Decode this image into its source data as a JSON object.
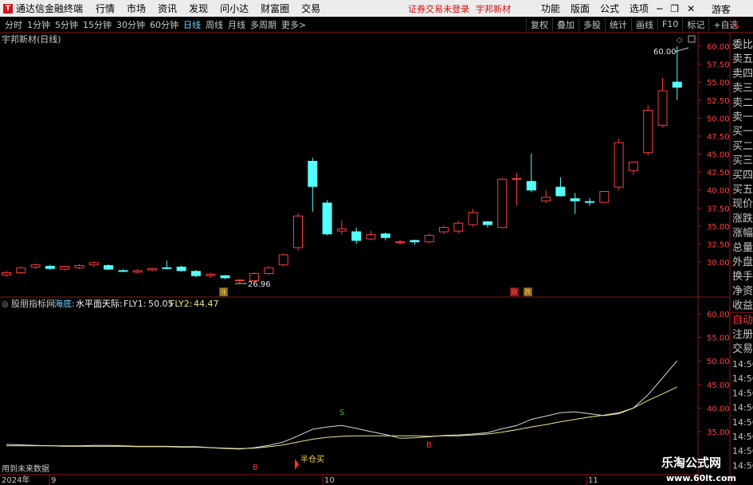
{
  "app": {
    "title": "通达信金融终端",
    "menus": [
      "行情",
      "市场",
      "资讯",
      "发现",
      "问小达",
      "财富圈",
      "交易"
    ],
    "status_left": "证券交易未登录",
    "status_right": "宇邦新材",
    "right_menus": [
      "功能",
      "版面",
      "公式",
      "选项"
    ],
    "guest": "游客"
  },
  "periods": [
    "分时",
    "1分钟",
    "5分钟",
    "15分钟",
    "30分钟",
    "60分钟",
    "日线",
    "周线",
    "月线",
    "多周期",
    "更多>"
  ],
  "active_period": "日线",
  "toolbar": [
    "复权",
    "叠加",
    "多股",
    "统计",
    "画线",
    "F10",
    "标记",
    "+自选"
  ],
  "right_tab": "L",
  "side_tabs": [
    "委比",
    "卖五",
    "卖四",
    "卖三",
    "卖二",
    "卖一",
    "买一",
    "买二",
    "买三",
    "买四",
    "买五",
    "现价",
    "涨跌",
    "涨幅",
    "总量",
    "外盘",
    "换手",
    "净资",
    "收益",
    "自动",
    "注册",
    "交易"
  ],
  "side_times": [
    "14:56",
    "14:56",
    "14:56",
    "14:56",
    "14:56",
    "14:56",
    "14:56",
    "14:56"
  ],
  "watermark": {
    "name": "乐淘公式网",
    "url": "www.60lt.com"
  },
  "bottom": {
    "note": "用到未来数据",
    "year": "2024年",
    "months": [
      "9",
      "10",
      "11"
    ]
  },
  "chart_data": [
    {
      "type": "candlestick",
      "title": "宇邦新材(日线)",
      "ylim": [
        27.5,
        62
      ],
      "yticks": [
        "60.00",
        "57.50",
        "55.00",
        "52.50",
        "50.00",
        "47.50",
        "45.00",
        "42.50",
        "40.00",
        "37.50",
        "35.00",
        "32.50",
        "30.00"
      ],
      "annotations": {
        "high": "60.00",
        "low": "26.96",
        "marker1": "涨",
        "marker2": "跌",
        "marker3": "跌"
      },
      "ohlc": [
        [
          28.2,
          28.8,
          27.9,
          28.5
        ],
        [
          28.5,
          29.4,
          28.3,
          29.2
        ],
        [
          29.3,
          29.8,
          29.0,
          29.6
        ],
        [
          29.4,
          29.6,
          28.9,
          29.1
        ],
        [
          29.0,
          29.5,
          28.8,
          29.4
        ],
        [
          29.2,
          29.7,
          29.0,
          29.5
        ],
        [
          29.6,
          30.1,
          29.3,
          29.9
        ],
        [
          29.5,
          29.7,
          28.9,
          29.0
        ],
        [
          28.8,
          29.0,
          28.6,
          28.7
        ],
        [
          28.6,
          29.0,
          28.4,
          28.8
        ],
        [
          28.9,
          29.2,
          28.7,
          29.1
        ],
        [
          29.2,
          30.2,
          29.0,
          29.1
        ],
        [
          29.3,
          29.5,
          28.7,
          28.8
        ],
        [
          28.7,
          28.9,
          27.9,
          28.1
        ],
        [
          28.1,
          28.5,
          27.8,
          28.3
        ],
        [
          28.1,
          28.2,
          27.6,
          27.8
        ],
        [
          27.5,
          27.6,
          26.96,
          27.5
        ],
        [
          27.4,
          28.6,
          27.2,
          28.4
        ],
        [
          28.4,
          29.4,
          28.2,
          29.2
        ],
        [
          29.6,
          31.2,
          29.4,
          31.0
        ],
        [
          32.0,
          36.8,
          31.6,
          36.4
        ],
        [
          44.0,
          44.5,
          37.0,
          40.5
        ],
        [
          38.2,
          38.6,
          33.7,
          33.9
        ],
        [
          34.3,
          35.8,
          33.8,
          34.6
        ],
        [
          34.2,
          34.8,
          32.5,
          33.0
        ],
        [
          33.2,
          34.3,
          33.0,
          33.8
        ],
        [
          33.9,
          34.1,
          33.0,
          33.4
        ],
        [
          32.7,
          33.1,
          32.4,
          32.8
        ],
        [
          33.0,
          33.1,
          32.4,
          32.8
        ],
        [
          32.8,
          34.0,
          32.6,
          33.7
        ],
        [
          34.2,
          35.1,
          33.9,
          34.8
        ],
        [
          34.3,
          35.7,
          34.0,
          35.4
        ],
        [
          35.2,
          37.4,
          34.9,
          36.9
        ],
        [
          35.6,
          35.7,
          34.8,
          35.2
        ],
        [
          34.8,
          41.7,
          34.7,
          41.5
        ],
        [
          41.6,
          42.4,
          37.8,
          41.6
        ],
        [
          41.2,
          45.1,
          39.7,
          40.0
        ],
        [
          38.5,
          40.0,
          38.2,
          39.0
        ],
        [
          40.4,
          41.8,
          39.1,
          39.2
        ],
        [
          38.8,
          39.6,
          36.7,
          38.5
        ],
        [
          38.4,
          38.9,
          37.8,
          38.3
        ],
        [
          38.3,
          39.9,
          38.2,
          39.8
        ],
        [
          40.4,
          47.2,
          40.0,
          46.6
        ],
        [
          42.7,
          44.0,
          42.1,
          43.9
        ],
        [
          45.2,
          51.8,
          44.8,
          51.1
        ],
        [
          49.0,
          55.6,
          48.7,
          53.8
        ],
        [
          55.0,
          60.0,
          52.5,
          54.3
        ]
      ]
    },
    {
      "type": "line",
      "title": "股朋指标网",
      "legend": {
        "l1": "海底:",
        "l2": "水平面:",
        "l3": "天际:",
        "fly1_label": "FLY1:",
        "fly1_value": "50.05",
        "fly2_label": "FLY2:",
        "fly2_value": "44.47"
      },
      "ylim": [
        31,
        63
      ],
      "yticks": [
        "60.00",
        "55.00",
        "50.00",
        "45.00",
        "40.00",
        "35.00"
      ],
      "signals": {
        "b1": "B",
        "b2": "B",
        "s1": "S",
        "buy_text": "半仓买"
      },
      "series": [
        {
          "name": "FLY1",
          "values": [
            32.3,
            32.2,
            32.1,
            32.0,
            32.0,
            32.0,
            32.1,
            32.1,
            32.0,
            31.9,
            31.9,
            31.9,
            31.8,
            31.8,
            31.6,
            31.4,
            31.3,
            31.6,
            32.1,
            32.8,
            34.1,
            35.5,
            36.0,
            36.3,
            35.7,
            35.0,
            34.4,
            33.6,
            33.7,
            33.9,
            34.2,
            34.3,
            34.5,
            34.8,
            35.6,
            36.3,
            37.6,
            38.3,
            39.0,
            39.2,
            38.8,
            38.4,
            38.8,
            40.0,
            42.8,
            46.4,
            50.05
          ]
        },
        {
          "name": "FLY2",
          "values": [
            32.0,
            32.0,
            32.0,
            32.0,
            31.9,
            31.9,
            31.9,
            31.9,
            31.9,
            31.8,
            31.8,
            31.8,
            31.7,
            31.7,
            31.6,
            31.5,
            31.4,
            31.5,
            31.8,
            32.2,
            32.8,
            33.4,
            33.8,
            34.0,
            34.1,
            34.1,
            34.1,
            34.1,
            34.1,
            34.0,
            34.1,
            34.1,
            34.3,
            34.5,
            34.9,
            35.4,
            36.0,
            36.5,
            37.1,
            37.6,
            38.1,
            38.5,
            39.0,
            40.0,
            41.6,
            43.0,
            44.47
          ]
        }
      ]
    }
  ]
}
